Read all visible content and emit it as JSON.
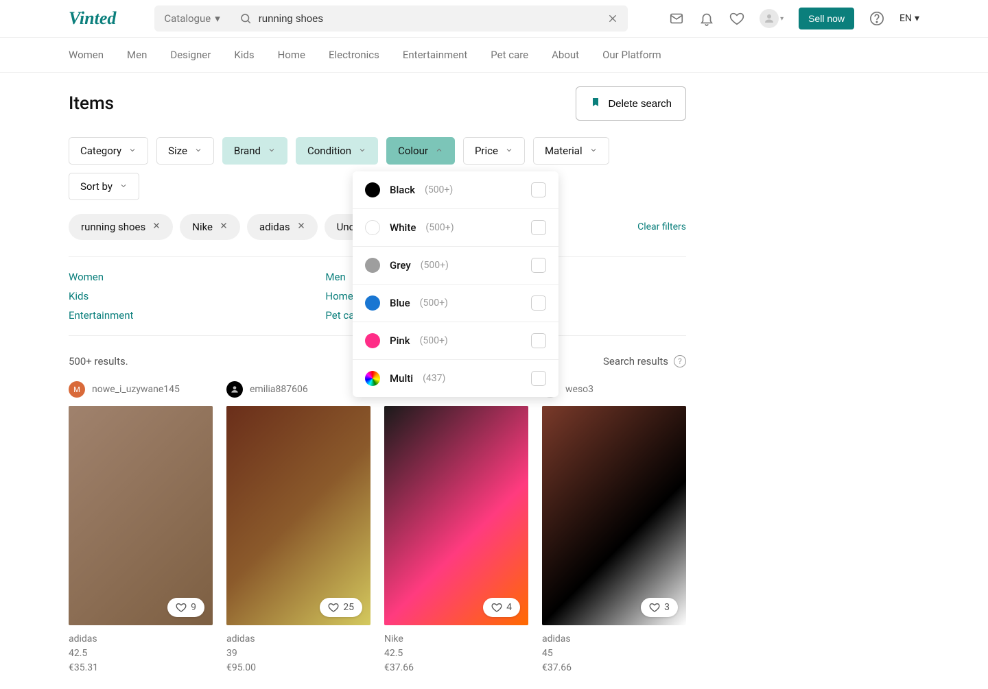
{
  "header": {
    "logo": "Vinted",
    "catalogue": "Catalogue",
    "search_value": "running shoes",
    "sell_label": "Sell now",
    "lang": "EN"
  },
  "nav": [
    "Women",
    "Men",
    "Designer",
    "Kids",
    "Home",
    "Electronics",
    "Entertainment",
    "Pet care",
    "About",
    "Our Platform"
  ],
  "page": {
    "title": "Items",
    "delete_label": "Delete search",
    "results_text": "500+ results.",
    "search_results_label": "Search results",
    "clear_filters": "Clear filters"
  },
  "filters": [
    {
      "label": "Category",
      "state": "normal"
    },
    {
      "label": "Size",
      "state": "normal"
    },
    {
      "label": "Brand",
      "state": "active"
    },
    {
      "label": "Condition",
      "state": "active"
    },
    {
      "label": "Colour",
      "state": "open"
    },
    {
      "label": "Price",
      "state": "normal"
    },
    {
      "label": "Material",
      "state": "normal"
    },
    {
      "label": "Sort by",
      "state": "normal"
    }
  ],
  "chips": [
    "running shoes",
    "Nike",
    "adidas",
    "Under Arm"
  ],
  "categories_col1": [
    "Women",
    "Kids",
    "Entertainment"
  ],
  "categories_col2": [
    "Men",
    "Home",
    "Pet care"
  ],
  "colour_options": [
    {
      "name": "Black",
      "count": "(500+)",
      "hex": "#000000"
    },
    {
      "name": "White",
      "count": "(500+)",
      "hex": "#ffffff",
      "border": true
    },
    {
      "name": "Grey",
      "count": "(500+)",
      "hex": "#9e9e9e"
    },
    {
      "name": "Blue",
      "count": "(500+)",
      "hex": "#1976d2"
    },
    {
      "name": "Pink",
      "count": "(500+)",
      "hex": "#ff2d87"
    },
    {
      "name": "Multi",
      "count": "(437)",
      "hex": "conic"
    }
  ],
  "products": [
    {
      "seller": "nowe_i_uzywane145",
      "avatar_bg": "#d96a3a",
      "avatar_txt": "M",
      "likes": "9",
      "brand": "adidas",
      "size": "42.5",
      "price": "€35.31",
      "img": "img1"
    },
    {
      "seller": "emilia887606",
      "avatar_bg": "#000000",
      "avatar_txt": "",
      "likes": "25",
      "brand": "adidas",
      "size": "39",
      "price": "€95.00",
      "img": "img2"
    },
    {
      "seller": "",
      "avatar_bg": "",
      "avatar_txt": "",
      "likes": "4",
      "brand": "Nike",
      "size": "42.5",
      "price": "€37.66",
      "img": "img3"
    },
    {
      "seller": "weso3",
      "avatar_bg": "#e0e0e0",
      "avatar_txt": "",
      "likes": "3",
      "brand": "adidas",
      "size": "45",
      "price": "€37.66",
      "img": "img4"
    }
  ]
}
